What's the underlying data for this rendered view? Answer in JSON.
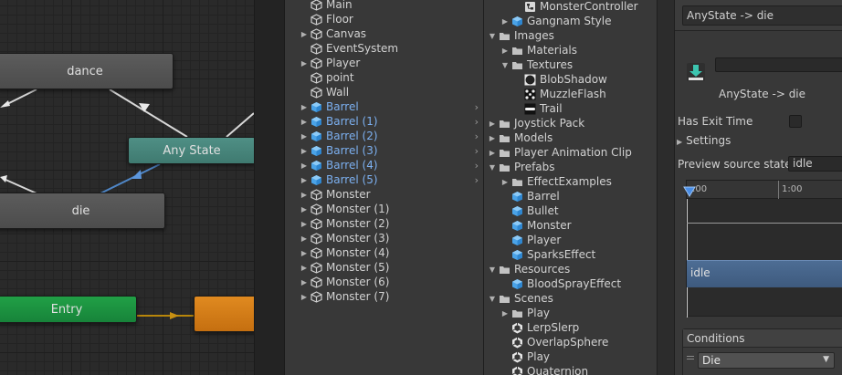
{
  "animator": {
    "nodes": {
      "dance": "dance",
      "any_state": "Any State",
      "die": "die",
      "entry": "Entry"
    }
  },
  "hierarchy": {
    "items": [
      {
        "label": "Main",
        "arrow": false,
        "icon": "cube",
        "blue": false
      },
      {
        "label": "Floor",
        "arrow": false,
        "icon": "cube",
        "blue": false
      },
      {
        "label": "Canvas",
        "arrow": true,
        "icon": "cube",
        "blue": false
      },
      {
        "label": "EventSystem",
        "arrow": false,
        "icon": "cube",
        "blue": false
      },
      {
        "label": "Player",
        "arrow": true,
        "icon": "cube",
        "blue": false
      },
      {
        "label": "point",
        "arrow": false,
        "icon": "cube",
        "blue": false
      },
      {
        "label": "Wall",
        "arrow": false,
        "icon": "cube",
        "blue": false
      },
      {
        "label": "Barrel",
        "arrow": true,
        "icon": "prefab",
        "blue": true
      },
      {
        "label": "Barrel (1)",
        "arrow": true,
        "icon": "prefab",
        "blue": true
      },
      {
        "label": "Barrel (2)",
        "arrow": true,
        "icon": "prefab",
        "blue": true
      },
      {
        "label": "Barrel (3)",
        "arrow": true,
        "icon": "prefab",
        "blue": true
      },
      {
        "label": "Barrel (4)",
        "arrow": true,
        "icon": "prefab",
        "blue": true
      },
      {
        "label": "Barrel (5)",
        "arrow": true,
        "icon": "prefab",
        "blue": true
      },
      {
        "label": "Monster",
        "arrow": true,
        "icon": "cube",
        "blue": false
      },
      {
        "label": "Monster (1)",
        "arrow": true,
        "icon": "cube",
        "blue": false
      },
      {
        "label": "Monster (2)",
        "arrow": true,
        "icon": "cube",
        "blue": false
      },
      {
        "label": "Monster (3)",
        "arrow": true,
        "icon": "cube",
        "blue": false
      },
      {
        "label": "Monster (4)",
        "arrow": true,
        "icon": "cube",
        "blue": false
      },
      {
        "label": "Monster (5)",
        "arrow": true,
        "icon": "cube",
        "blue": false
      },
      {
        "label": "Monster (6)",
        "arrow": true,
        "icon": "cube",
        "blue": false
      },
      {
        "label": "Monster (7)",
        "arrow": true,
        "icon": "cube",
        "blue": false
      }
    ]
  },
  "project": {
    "items": [
      {
        "label": "MonsterController",
        "indent": 3,
        "arrow": "",
        "icon": "controller"
      },
      {
        "label": "Gangnam Style",
        "indent": 2,
        "arrow": "right",
        "icon": "prefab"
      },
      {
        "label": "Images",
        "indent": 1,
        "arrow": "down",
        "icon": "folder"
      },
      {
        "label": "Materials",
        "indent": 2,
        "arrow": "right",
        "icon": "folder"
      },
      {
        "label": "Textures",
        "indent": 2,
        "arrow": "down",
        "icon": "folder"
      },
      {
        "label": "BlobShadow",
        "indent": 3,
        "arrow": "",
        "icon": "blob"
      },
      {
        "label": "MuzzleFlash",
        "indent": 3,
        "arrow": "",
        "icon": "muzzle"
      },
      {
        "label": "Trail",
        "indent": 3,
        "arrow": "",
        "icon": "trail"
      },
      {
        "label": "Joystick Pack",
        "indent": 1,
        "arrow": "right",
        "icon": "folder"
      },
      {
        "label": "Models",
        "indent": 1,
        "arrow": "right",
        "icon": "folder"
      },
      {
        "label": "Player Animation Clip",
        "indent": 1,
        "arrow": "right",
        "icon": "folder"
      },
      {
        "label": "Prefabs",
        "indent": 1,
        "arrow": "down",
        "icon": "folder"
      },
      {
        "label": "EffectExamples",
        "indent": 2,
        "arrow": "right",
        "icon": "folder"
      },
      {
        "label": "Barrel",
        "indent": 2,
        "arrow": "",
        "icon": "prefab"
      },
      {
        "label": "Bullet",
        "indent": 2,
        "arrow": "",
        "icon": "prefab"
      },
      {
        "label": "Monster",
        "indent": 2,
        "arrow": "",
        "icon": "prefab"
      },
      {
        "label": "Player",
        "indent": 2,
        "arrow": "",
        "icon": "prefab"
      },
      {
        "label": "SparksEffect",
        "indent": 2,
        "arrow": "",
        "icon": "prefab"
      },
      {
        "label": "Resources",
        "indent": 1,
        "arrow": "down",
        "icon": "folder"
      },
      {
        "label": "BloodSprayEffect",
        "indent": 2,
        "arrow": "",
        "icon": "prefab"
      },
      {
        "label": "Scenes",
        "indent": 1,
        "arrow": "down",
        "icon": "folder"
      },
      {
        "label": "Play",
        "indent": 2,
        "arrow": "right",
        "icon": "folder"
      },
      {
        "label": "LerpSlerp",
        "indent": 2,
        "arrow": "",
        "icon": "unity"
      },
      {
        "label": "OverlapSphere",
        "indent": 2,
        "arrow": "",
        "icon": "unity"
      },
      {
        "label": "Play",
        "indent": 2,
        "arrow": "",
        "icon": "unity"
      },
      {
        "label": "Quaternion",
        "indent": 2,
        "arrow": "",
        "icon": "unity"
      }
    ]
  },
  "inspector": {
    "header_title": "AnyState -> die",
    "transition_name": "AnyState -> die",
    "has_exit_time_label": "Has Exit Time",
    "settings_label": "Settings",
    "preview_label": "Preview source state",
    "preview_value": "idle",
    "timeline_tick_0": ":00",
    "timeline_tick_1": "1:00",
    "timeline_state": "idle",
    "conditions_label": "Conditions",
    "condition_value": "Die"
  },
  "colors": {
    "any_state": "#468479",
    "entry": "#1d9140",
    "orange_state": "#d57d18",
    "selected_blue": "#7cb0f0"
  }
}
